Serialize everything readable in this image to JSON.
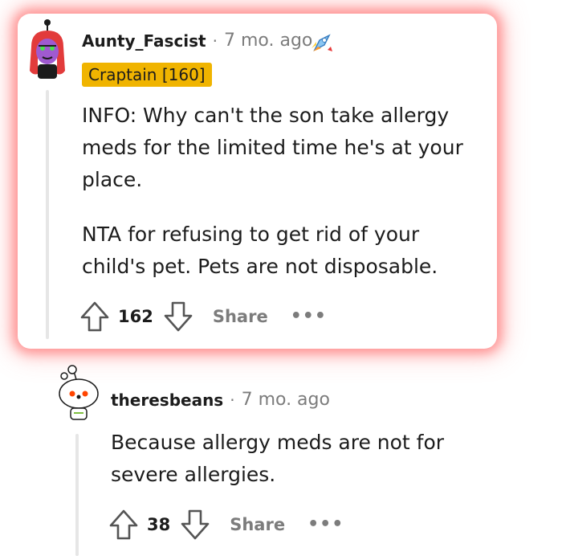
{
  "comments": [
    {
      "username": "Aunty_Fascist",
      "separator": "·",
      "time": "7 mo. ago",
      "flair": "Craptain [160]",
      "award_icon": "rocket-award-icon",
      "paragraphs": [
        "INFO: Why can't the son take allergy meds for the limited time he's at your place.",
        "NTA for refusing to get rid of your child's pet. Pets are not disposable."
      ],
      "votes": "162",
      "share_label": "Share",
      "more_label": "•••"
    },
    {
      "username": "theresbeans",
      "separator": "·",
      "time": "7 mo. ago",
      "paragraphs": [
        "Because allergy meds are not for severe allergies."
      ],
      "votes": "38",
      "share_label": "Share",
      "more_label": "•••"
    }
  ],
  "colors": {
    "flair_bg": "#f0b400",
    "glow": "#ff5a5a",
    "muted": "#7c7c7c",
    "text": "#1c1c1c"
  }
}
